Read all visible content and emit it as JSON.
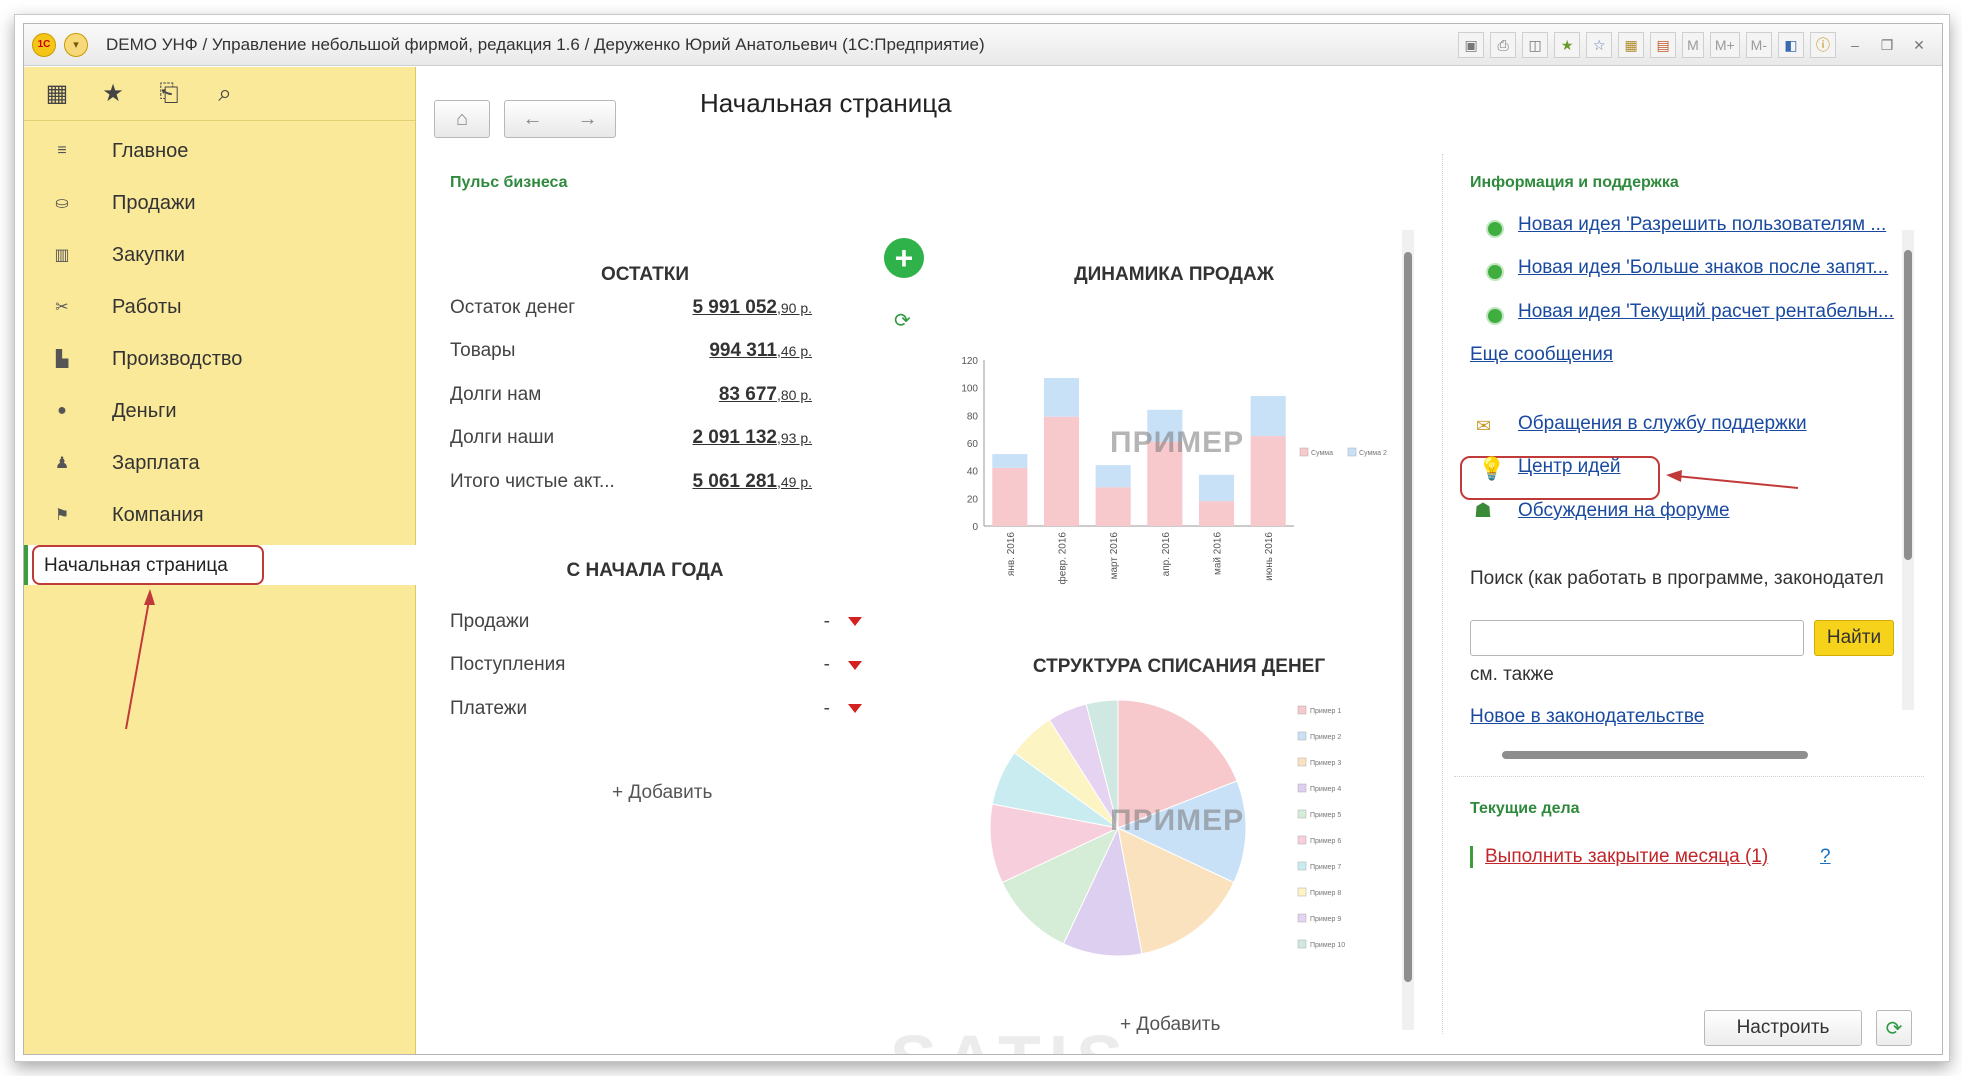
{
  "window": {
    "title": "DEMO УНФ  / Управление небольшой фирмой, редакция 1.6 / Деруженко Юрий Анатольевич  (1С:Предприятие)",
    "logo_text": "1С",
    "toolbar_m": [
      "M",
      "M+",
      "M-"
    ]
  },
  "sidebar": {
    "items": [
      {
        "label": "Главное",
        "icon": "menu-lines-icon"
      },
      {
        "label": "Продажи",
        "icon": "basket-icon"
      },
      {
        "label": "Закупки",
        "icon": "purchases-icon"
      },
      {
        "label": "Работы",
        "icon": "tools-icon"
      },
      {
        "label": "Производство",
        "icon": "factory-icon"
      },
      {
        "label": "Деньги",
        "icon": "money-icon"
      },
      {
        "label": "Зарплата",
        "icon": "people-icon"
      },
      {
        "label": "Компания",
        "icon": "flag-icon"
      }
    ],
    "home": "Начальная страница"
  },
  "header": {
    "title": "Начальная страница"
  },
  "pulse": {
    "heading": "Пульс бизнеса",
    "balances": {
      "title": "ОСТАТКИ",
      "rows": [
        {
          "label": "Остаток денег",
          "value": "5 991 052",
          "cents": ",90 р."
        },
        {
          "label": "Товары",
          "value": "994 311",
          "cents": ",46 р."
        },
        {
          "label": "Долги нам",
          "value": "83 677",
          "cents": ",80 р."
        },
        {
          "label": "Долги наши",
          "value": "2 091 132",
          "cents": ",93 р."
        },
        {
          "label": "Итого чистые акт...",
          "value": "5 061 281",
          "cents": ",49 р."
        }
      ]
    },
    "ytd": {
      "title": "С НАЧАЛА ГОДА",
      "rows": [
        {
          "label": "Продажи",
          "value": "-"
        },
        {
          "label": "Поступления",
          "value": "-"
        },
        {
          "label": "Платежи",
          "value": "-"
        }
      ]
    },
    "add_left": "+ Добавить",
    "add_right": "+ Добавить",
    "sales_title": "ДИНАМИКА ПРОДАЖ",
    "writeoff_title": "СТРУКТУРА СПИСАНИЯ ДЕНЕГ",
    "example_label": "ПРИМЕР"
  },
  "chart_data": [
    {
      "type": "bar",
      "title": "ДИНАМИКА ПРОДАЖ",
      "categories": [
        "янв. 2016",
        "февр. 2016",
        "март 2016",
        "апр. 2016",
        "май 2016",
        "июнь 2016"
      ],
      "series": [
        {
          "name": "Сумма",
          "values": [
            42,
            79,
            28,
            61,
            18,
            65
          ],
          "color": "#f7c9cc"
        },
        {
          "name": "Сумма 2",
          "values": [
            10,
            28,
            16,
            23,
            19,
            29
          ],
          "color": "#c9e1f7"
        }
      ],
      "stacked": true,
      "ylim": [
        0,
        120
      ],
      "yticks": [
        0,
        20,
        40,
        60,
        80,
        100,
        120
      ],
      "legend": "right"
    },
    {
      "type": "pie",
      "title": "СТРУКТУРА СПИСАНИЯ ДЕНЕГ",
      "labels": [
        "Пример 1",
        "Пример 2",
        "Пример 3",
        "Пример 4",
        "Пример 5",
        "Пример 6",
        "Пример 7",
        "Пример 8",
        "Пример 9",
        "Пример 10"
      ],
      "values": [
        19,
        13,
        15,
        10,
        11,
        10,
        7,
        6,
        5,
        4
      ],
      "colors": [
        "#f7c9cc",
        "#c9e1f7",
        "#fbe2bf",
        "#dccff0",
        "#d5ecd6",
        "#f7cfdc",
        "#c9ecf1",
        "#fdf4c4",
        "#e6d3f1",
        "#cfe9e2"
      ],
      "legend": "right"
    }
  ],
  "info": {
    "heading": "Информация и поддержка",
    "news": [
      "Новая идея 'Разрешить пользователям ...",
      "Новая идея 'Больше знаков после запят...",
      "Новая идея 'Текущий расчет рентабельн..."
    ],
    "more": "Еще сообщения",
    "support": "Обращения в службу поддержки",
    "ideas": "Центр идей",
    "forum": "Обсуждения на форуме",
    "search_label": "Поиск (как работать в программе, законодател",
    "search_value": "",
    "find_button": "Найти",
    "see_also": "см. также",
    "legislation": "Новое в законодательстве"
  },
  "tasks": {
    "heading": "Текущие дела",
    "items": [
      "Выполнить закрытие месяца (1)"
    ],
    "help": "?",
    "configure": "Настроить"
  },
  "watermark": "SATIS"
}
